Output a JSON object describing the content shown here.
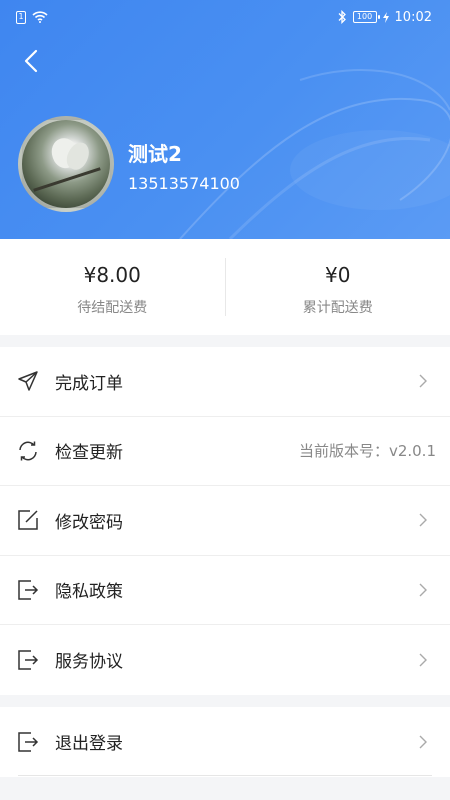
{
  "status_bar": {
    "time": "10:02",
    "battery": "100",
    "sim": "1"
  },
  "profile": {
    "name": "测试2",
    "phone": "13513574100"
  },
  "stats": [
    {
      "value": "¥8.00",
      "label": "待结配送费"
    },
    {
      "value": "¥0",
      "label": "累计配送费"
    }
  ],
  "menu": {
    "complete_orders": "完成订单",
    "check_update": "检查更新",
    "version_text": "当前版本号：v2.0.1",
    "change_password": "修改密码",
    "privacy_policy": "隐私政策",
    "service_agreement": "服务协议",
    "logout": "退出登录"
  },
  "colors": {
    "header_blue": "#4a90f2",
    "text_dark": "#222222",
    "text_gray": "#888888"
  },
  "icons": [
    "back-icon",
    "send-icon",
    "refresh-icon",
    "edit-icon",
    "exit-icon",
    "chevron-right-icon",
    "wifi-icon",
    "bluetooth-icon",
    "battery-icon"
  ]
}
